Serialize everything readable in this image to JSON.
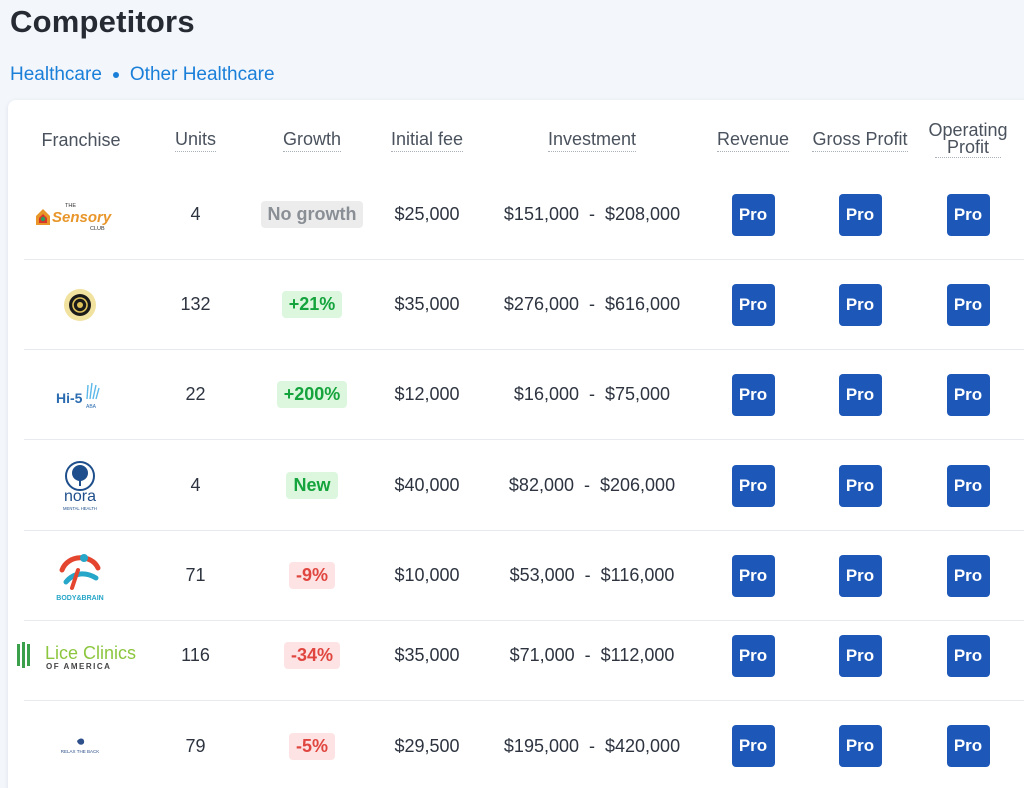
{
  "page": {
    "title": "Competitors"
  },
  "breadcrumb": [
    "Healthcare",
    "Other Healthcare"
  ],
  "columns": {
    "franchise": "Franchise",
    "units": "Units",
    "growth": "Growth",
    "initial_fee": "Initial fee",
    "investment": "Investment",
    "revenue": "Revenue",
    "gross_profit": "Gross Profit",
    "operating_profit_line1": "Operating",
    "operating_profit_line2": "Profit"
  },
  "pro_label": "Pro",
  "colors": {
    "pro": "#1d58b8",
    "link": "#1a7fd9",
    "growth_up": "#14a33c",
    "growth_down": "#e0463f"
  },
  "rows": [
    {
      "logo": "the-sensory-club-logo",
      "logo_text": "Sensory",
      "logo_top": "THE",
      "logo_bottom": "CLUB",
      "units": "4",
      "growth": "No growth",
      "growth_kind": "none",
      "initial_fee": "$25,000",
      "inv_low": "$151,000",
      "inv_high": "$208,000"
    },
    {
      "logo": "round-emblem-logo",
      "units": "132",
      "growth": "+21%",
      "growth_kind": "up",
      "initial_fee": "$35,000",
      "inv_low": "$276,000",
      "inv_high": "$616,000"
    },
    {
      "logo": "hi-5-aba-logo",
      "logo_text": "Hi-5",
      "logo_bottom": "ABA",
      "units": "22",
      "growth": "+200%",
      "growth_kind": "up",
      "initial_fee": "$12,000",
      "inv_low": "$16,000",
      "inv_high": "$75,000"
    },
    {
      "logo": "nora-mental-health-logo",
      "logo_text": "nora",
      "logo_bottom": "MENTAL HEALTH",
      "units": "4",
      "growth": "New",
      "growth_kind": "up",
      "initial_fee": "$40,000",
      "inv_low": "$82,000",
      "inv_high": "$206,000"
    },
    {
      "logo": "body-and-brain-logo",
      "logo_text": "BODY&BRAIN",
      "units": "71",
      "growth": "-9%",
      "growth_kind": "down",
      "initial_fee": "$10,000",
      "inv_low": "$53,000",
      "inv_high": "$116,000"
    },
    {
      "logo": "lice-clinics-of-america-logo",
      "logo_text": "Lice Clinics",
      "logo_bottom": "OF AMERICA",
      "units": "116",
      "growth": "-34%",
      "growth_kind": "down",
      "initial_fee": "$35,000",
      "inv_low": "$71,000",
      "inv_high": "$112,000"
    },
    {
      "logo": "relax-the-back-logo",
      "logo_text": "RELAX THE BACK",
      "units": "79",
      "growth": "-5%",
      "growth_kind": "down",
      "initial_fee": "$29,500",
      "inv_low": "$195,000",
      "inv_high": "$420,000"
    }
  ]
}
